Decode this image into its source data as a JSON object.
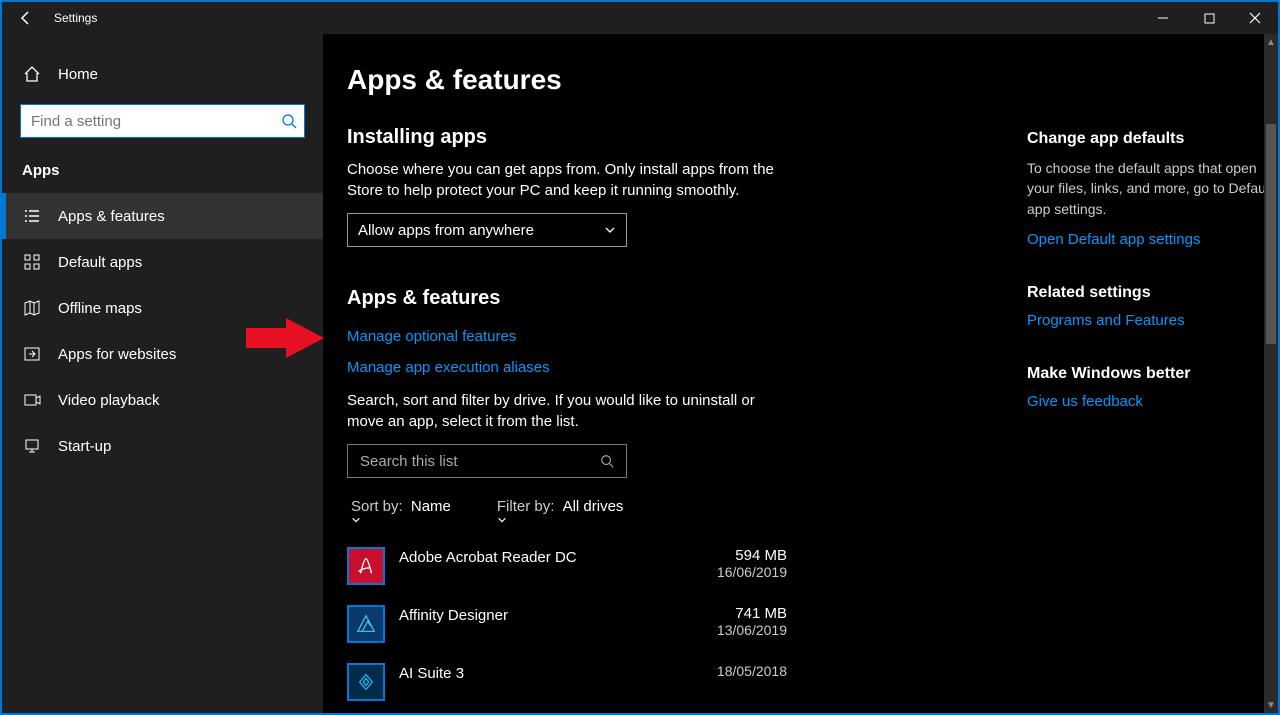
{
  "window": {
    "title": "Settings"
  },
  "sidebar": {
    "home": "Home",
    "search_placeholder": "Find a setting",
    "section": "Apps",
    "items": [
      {
        "label": "Apps & features"
      },
      {
        "label": "Default apps"
      },
      {
        "label": "Offline maps"
      },
      {
        "label": "Apps for websites"
      },
      {
        "label": "Video playback"
      },
      {
        "label": "Start-up"
      }
    ]
  },
  "main": {
    "title": "Apps & features",
    "installing_head": "Installing apps",
    "installing_body": "Choose where you can get apps from. Only install apps from the Store to help protect your PC and keep it running smoothly.",
    "source_select": "Allow apps from anywhere",
    "apps_head": "Apps & features",
    "link_optional": "Manage optional features",
    "link_aliases": "Manage app execution aliases",
    "list_help": "Search, sort and filter by drive. If you would like to uninstall or move an app, select it from the list.",
    "search_placeholder": "Search this list",
    "sort_label": "Sort by:",
    "sort_value": "Name",
    "filter_label": "Filter by:",
    "filter_value": "All drives",
    "apps": [
      {
        "name": "Adobe Acrobat Reader DC",
        "size": "594 MB",
        "date": "16/06/2019",
        "icon": "acrobat"
      },
      {
        "name": "Affinity Designer",
        "size": "741 MB",
        "date": "13/06/2019",
        "icon": "affinity"
      },
      {
        "name": "AI Suite 3",
        "size": "",
        "date": "18/05/2018",
        "icon": "aisuite"
      }
    ]
  },
  "right": {
    "defaults_title": "Change app defaults",
    "defaults_body": "To choose the default apps that open your files, links, and more, go to Default app settings.",
    "defaults_link": "Open Default app settings",
    "related_title": "Related settings",
    "related_link": "Programs and Features",
    "better_title": "Make Windows better",
    "better_link": "Give us feedback"
  }
}
